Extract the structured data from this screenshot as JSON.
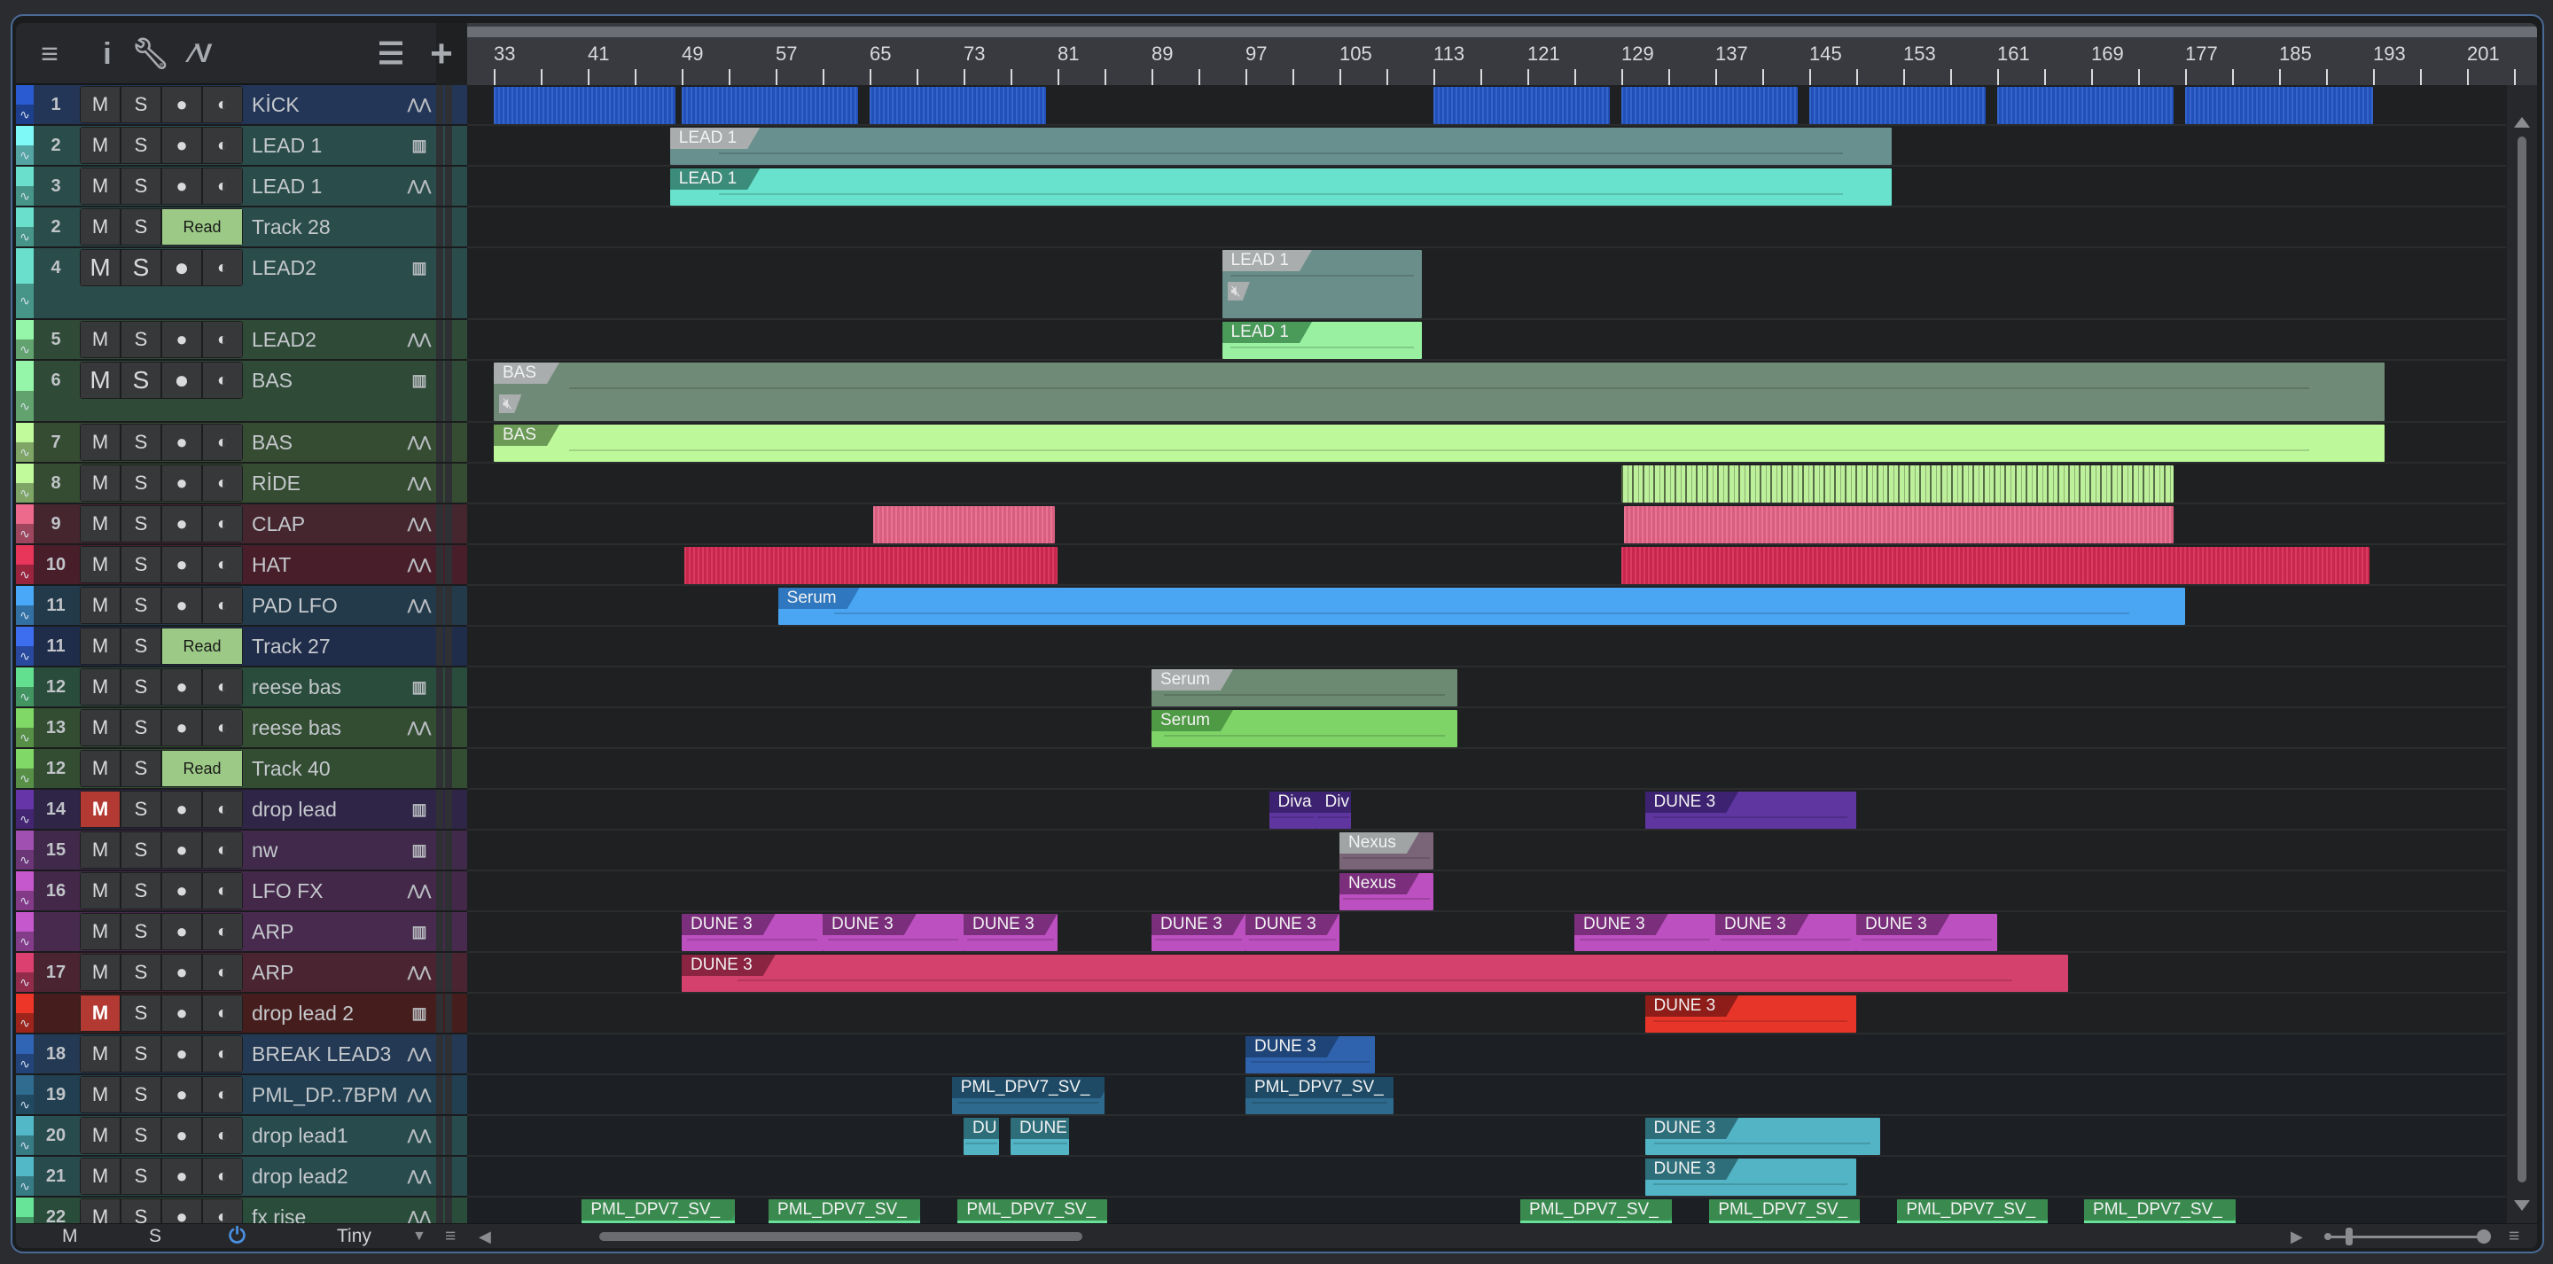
{
  "toolbar": {
    "icons": [
      "menu-icon",
      "info-icon",
      "wrench-icon",
      "automation-curve-icon",
      "track-list-icon",
      "add-track-icon"
    ]
  },
  "buttons": {
    "mute": "M",
    "solo": "S",
    "read": "Read"
  },
  "tracks": [
    {
      "num": "1",
      "name": "KİCK",
      "icon": "wave",
      "color": "#2a5bd0",
      "bg": "#233657"
    },
    {
      "num": "2",
      "name": "LEAD 1",
      "icon": "piano",
      "color": "#7ff8f8",
      "bg": "#2a4d4b"
    },
    {
      "num": "3",
      "name": "LEAD 1",
      "icon": "wave",
      "color": "#6ae0cc",
      "bg": "#2a4d4b"
    },
    {
      "num": "2",
      "name": "Track 28",
      "mode": "Read",
      "color": "#6ae0cc",
      "bg": "#2a4d4b"
    },
    {
      "num": "4",
      "name": "LEAD2",
      "icon": "piano",
      "color": "#6ae0cc",
      "bg": "#2a4d4b"
    },
    {
      "num": "5",
      "name": "LEAD2",
      "icon": "wave",
      "color": "#95f5a8",
      "bg": "#304a38"
    },
    {
      "num": "6",
      "name": "BAS",
      "icon": "piano",
      "color": "#95f5a8",
      "bg": "#304a38"
    },
    {
      "num": "7",
      "name": "BAS",
      "icon": "wave",
      "color": "#c0fa9a",
      "bg": "#354c32"
    },
    {
      "num": "8",
      "name": "RİDE",
      "icon": "wave",
      "color": "#c0fa9a",
      "bg": "#354c32"
    },
    {
      "num": "9",
      "name": "CLAP",
      "icon": "wave",
      "color": "#ee6a8c",
      "bg": "#45262f"
    },
    {
      "num": "10",
      "name": "HAT",
      "icon": "wave",
      "color": "#e8355a",
      "bg": "#481e2b"
    },
    {
      "num": "11",
      "name": "PAD LFO",
      "icon": "wave",
      "color": "#4aa8f8",
      "bg": "#233a4a"
    },
    {
      "num": "11",
      "name": "Track 27",
      "mode": "Read",
      "color": "#3e6ef0",
      "bg": "#1f2c4a"
    },
    {
      "num": "12",
      "name": "reese bas",
      "icon": "piano",
      "color": "#62e090",
      "bg": "#2a4c3c"
    },
    {
      "num": "13",
      "name": "reese bas",
      "icon": "wave",
      "color": "#80d866",
      "bg": "#334d33"
    },
    {
      "num": "12",
      "name": "Track 40",
      "mode": "Read",
      "color": "#80d866",
      "bg": "#334d33"
    },
    {
      "num": "14",
      "name": "drop lead",
      "icon": "piano",
      "color": "#6636a8",
      "bg": "#2f2547",
      "muted": true
    },
    {
      "num": "15",
      "name": "nw",
      "icon": "piano",
      "color": "#a050b0",
      "bg": "#40294a"
    },
    {
      "num": "16",
      "name": "LFO FX",
      "icon": "wave",
      "color": "#c558cc",
      "bg": "#43284a"
    },
    {
      "num": "",
      "name": "ARP",
      "icon": "piano",
      "color": "#c558cc",
      "bg": "#482a4f"
    },
    {
      "num": "17",
      "name": "ARP",
      "icon": "wave",
      "color": "#dc4070",
      "bg": "#4a2531"
    },
    {
      "num": "",
      "name": "drop lead 2",
      "icon": "piano",
      "color": "#ee3628",
      "bg": "#461d1d",
      "muted": true
    },
    {
      "num": "18",
      "name": "BREAK LEAD3",
      "icon": "wave",
      "color": "#3064b4",
      "bg": "#243954"
    },
    {
      "num": "19",
      "name": "PML_DP..7BPM",
      "icon": "wave",
      "color": "#2f6c90",
      "bg": "#213f50"
    },
    {
      "num": "20",
      "name": "drop lead1",
      "icon": "wave",
      "color": "#52b8c8",
      "bg": "#284b4e"
    },
    {
      "num": "21",
      "name": "drop lead2",
      "icon": "wave",
      "color": "#52b8c8",
      "bg": "#284b4e"
    },
    {
      "num": "22",
      "name": "fx rise",
      "icon": "wave",
      "color": "#68e498",
      "bg": "#2a4c3a"
    }
  ],
  "ruler": {
    "labels": [
      33,
      41,
      49,
      57,
      65,
      73,
      81,
      89,
      97,
      105,
      113,
      121,
      129,
      137,
      145,
      153,
      161,
      169,
      177,
      185,
      193,
      201
    ]
  },
  "clips": [
    {
      "track": 0,
      "start": 33,
      "end": 48.5,
      "color": "#2457c8",
      "striped": true
    },
    {
      "track": 0,
      "start": 49,
      "end": 64,
      "color": "#2457c8",
      "striped": true
    },
    {
      "track": 0,
      "start": 65,
      "end": 80,
      "color": "#2457c8",
      "striped": true
    },
    {
      "track": 0,
      "start": 113,
      "end": 128,
      "color": "#2457c8",
      "striped": true
    },
    {
      "track": 0,
      "start": 129,
      "end": 144,
      "color": "#2457c8",
      "striped": true
    },
    {
      "track": 0,
      "start": 145,
      "end": 160,
      "color": "#2457c8",
      "striped": true
    },
    {
      "track": 0,
      "start": 161,
      "end": 176,
      "color": "#2457c8",
      "striped": true
    },
    {
      "track": 0,
      "start": 177,
      "end": 193,
      "color": "#2457c8",
      "striped": true
    },
    {
      "track": 1,
      "start": 48,
      "end": 152,
      "label": "LEAD 1",
      "color": "#67908e",
      "tag": "#a9adad"
    },
    {
      "track": 2,
      "start": 48,
      "end": 152,
      "label": "LEAD 1",
      "color": "#68e2cc",
      "tag": "#3c8c7c"
    },
    {
      "track": 4,
      "start": 95,
      "end": 112,
      "label": "LEAD 1",
      "color": "#6a8e8a",
      "tag": "#a9adad",
      "muted": true
    },
    {
      "track": 5,
      "start": 95,
      "end": 112,
      "label": "LEAD 1",
      "color": "#98f0a0",
      "tag": "#4a9a5a"
    },
    {
      "track": 6,
      "start": 33,
      "end": 194,
      "label": "BAS",
      "color": "#6f8a76",
      "tag": "#a9adad",
      "muted": true
    },
    {
      "track": 7,
      "start": 33,
      "end": 194,
      "label": "BAS",
      "color": "#bdf89a",
      "tag": "#6a9a56"
    },
    {
      "track": 8,
      "start": 129,
      "end": 176,
      "color": "#bdf09a",
      "stripedDark": true
    },
    {
      "track": 9,
      "start": 65.3,
      "end": 80.8,
      "color": "#e8668a",
      "striped": true
    },
    {
      "track": 9,
      "start": 129.2,
      "end": 176,
      "color": "#e8668a",
      "striped": true
    },
    {
      "track": 10,
      "start": 49.2,
      "end": 81,
      "color": "#d82a52",
      "striped": true
    },
    {
      "track": 10,
      "start": 129,
      "end": 192.7,
      "color": "#d82a52",
      "striped": true
    },
    {
      "track": 11,
      "start": 57.2,
      "end": 177,
      "label": "Serum",
      "color": "#4aa6f2",
      "tag": "#2f78c0"
    },
    {
      "track": 13,
      "start": 89,
      "end": 115,
      "label": "Serum",
      "color": "#6c8a72",
      "tag": "#a9adad"
    },
    {
      "track": 14,
      "start": 89,
      "end": 115,
      "label": "Serum",
      "color": "#7fd468",
      "tag": "#4f9a44"
    },
    {
      "track": 16,
      "start": 99,
      "end": 103,
      "label": "Diva",
      "color": "#5f35a0",
      "tag": "#3c2270"
    },
    {
      "track": 16,
      "start": 103,
      "end": 106,
      "label": "Div",
      "color": "#5f35a0",
      "tag": "#3c2270"
    },
    {
      "track": 16,
      "start": 131,
      "end": 149,
      "label": "DUNE 3",
      "color": "#5f35a0",
      "tag": "#3c2270"
    },
    {
      "track": 17,
      "start": 105,
      "end": 113,
      "label": "Nexus",
      "color": "#7a6478",
      "tag": "#a0a4a4"
    },
    {
      "track": 18,
      "start": 105,
      "end": 113,
      "label": "Nexus",
      "color": "#bd50c0",
      "tag": "#7a2e7c"
    },
    {
      "track": 19,
      "start": 49,
      "end": 61,
      "label": "DUNE 3",
      "color": "#bd50c0",
      "tag": "#7a2e7c"
    },
    {
      "track": 19,
      "start": 61,
      "end": 73,
      "label": "DUNE 3",
      "color": "#bd50c0",
      "tag": "#7a2e7c"
    },
    {
      "track": 19,
      "start": 73,
      "end": 81,
      "label": "DUNE 3",
      "color": "#bd50c0",
      "tag": "#7a2e7c"
    },
    {
      "track": 19,
      "start": 89,
      "end": 97,
      "label": "DUNE 3",
      "color": "#bd50c0",
      "tag": "#7a2e7c"
    },
    {
      "track": 19,
      "start": 97,
      "end": 105,
      "label": "DUNE 3",
      "color": "#bd50c0",
      "tag": "#7a2e7c"
    },
    {
      "track": 19,
      "start": 125,
      "end": 137,
      "label": "DUNE 3",
      "color": "#bd50c0",
      "tag": "#7a2e7c"
    },
    {
      "track": 19,
      "start": 137,
      "end": 149,
      "label": "DUNE 3",
      "color": "#bd50c0",
      "tag": "#7a2e7c"
    },
    {
      "track": 19,
      "start": 149,
      "end": 161,
      "label": "DUNE 3",
      "color": "#bd50c0",
      "tag": "#7a2e7c"
    },
    {
      "track": 20,
      "start": 49,
      "end": 167,
      "label": "DUNE 3",
      "color": "#d4416c",
      "tag": "#8a2440"
    },
    {
      "track": 21,
      "start": 131,
      "end": 149,
      "label": "DUNE 3",
      "color": "#e8352a",
      "tag": "#8e1c18"
    },
    {
      "track": 22,
      "start": 97,
      "end": 108,
      "label": "DUNE 3",
      "color": "#2f63ae",
      "tag": "#1e4478"
    },
    {
      "track": 23,
      "start": 72,
      "end": 85,
      "label": "PML_DPV7_SV_",
      "color": "#2e6a8e",
      "tag": "#1e4a66"
    },
    {
      "track": 23,
      "start": 97,
      "end": 109.6,
      "label": "PML_DPV7_SV_",
      "color": "#2e6a8e",
      "tag": "#1e4a66"
    },
    {
      "track": 24,
      "start": 73,
      "end": 76,
      "label": "DU",
      "color": "#52b4c4",
      "tag": "#2e6e7a"
    },
    {
      "track": 24,
      "start": 77,
      "end": 82,
      "label": "DUNE",
      "color": "#52b4c4",
      "tag": "#2e6e7a"
    },
    {
      "track": 24,
      "start": 131,
      "end": 151,
      "label": "DUNE 3",
      "color": "#52b4c4",
      "tag": "#2e6e7a"
    },
    {
      "track": 25,
      "start": 131,
      "end": 149,
      "label": "DUNE 3",
      "color": "#52b4c4",
      "tag": "#2e6e7a"
    },
    {
      "track": 26,
      "start": 40.5,
      "end": 53.5,
      "label": "PML_DPV7_SV_",
      "color": "#68e098",
      "tag": "#3a8a50"
    },
    {
      "track": 26,
      "start": 56.4,
      "end": 69.3,
      "label": "PML_DPV7_SV_",
      "color": "#68e098",
      "tag": "#3a8a50"
    },
    {
      "track": 26,
      "start": 72.5,
      "end": 85.2,
      "label": "PML_DPV7_SV_",
      "color": "#68e098",
      "tag": "#3a8a50"
    },
    {
      "track": 26,
      "start": 120.4,
      "end": 133.3,
      "label": "PML_DPV7_SV_",
      "color": "#68e098",
      "tag": "#3a8a50"
    },
    {
      "track": 26,
      "start": 136.5,
      "end": 149.3,
      "label": "PML_DPV7_SV_",
      "color": "#68e098",
      "tag": "#3a8a50"
    },
    {
      "track": 26,
      "start": 152.5,
      "end": 165.3,
      "label": "PML_DPV7_SV_",
      "color": "#68e098",
      "tag": "#3a8a50"
    },
    {
      "track": 26,
      "start": 168.4,
      "end": 181.3,
      "label": "PML_DPV7_SV_",
      "color": "#68e098",
      "tag": "#3a8a50"
    }
  ],
  "bottom": {
    "mute_all": "M",
    "solo_all": "S",
    "height_preset": "Tiny"
  },
  "accent": "#4a90e2"
}
